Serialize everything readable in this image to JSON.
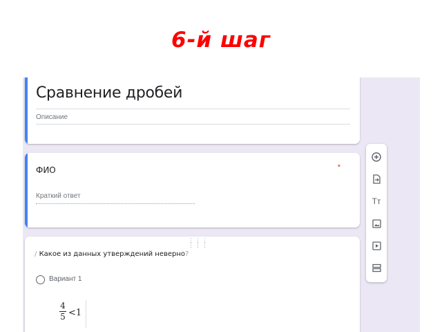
{
  "slide": {
    "title": "6-й шаг"
  },
  "form": {
    "title": "Сравнение дробей",
    "description": "Описание"
  },
  "fio_question": {
    "label": "ФИО",
    "required_mark": "*",
    "answer_placeholder": "Краткий ответ"
  },
  "question": {
    "text": "Какое из данных утверждений неверно",
    "option_label": "Вариант 1",
    "fraction": {
      "numerator": "4",
      "denominator": "5",
      "relation": "<1"
    }
  },
  "toolbar": {
    "icons": [
      "add-question-icon",
      "import-questions-icon",
      "title-text-icon",
      "image-icon",
      "video-icon",
      "section-icon"
    ],
    "text_tool_label": "Тт"
  },
  "colors": {
    "slide_title": "#ff0000",
    "accent": "#4285f4",
    "background": "#ebe7f4",
    "required": "#d93025"
  }
}
